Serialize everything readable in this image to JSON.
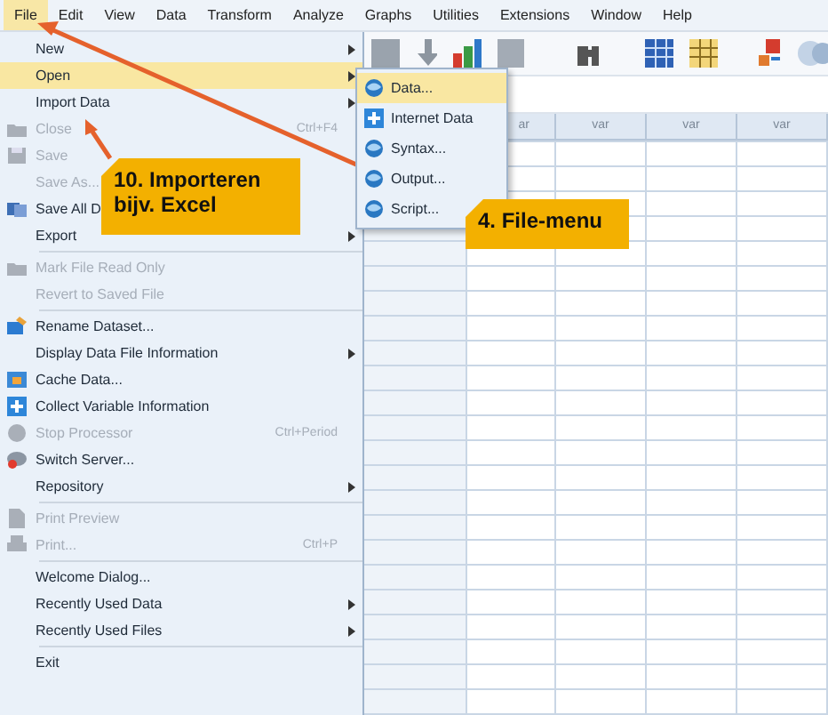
{
  "menu_bar": [
    {
      "label": "File",
      "selected": true
    },
    {
      "label": "Edit",
      "selected": false
    },
    {
      "label": "View",
      "selected": false
    },
    {
      "label": "Data",
      "selected": false
    },
    {
      "label": "Transform",
      "selected": false
    },
    {
      "label": "Analyze",
      "selected": false
    },
    {
      "label": "Graphs",
      "selected": false
    },
    {
      "label": "Utilities",
      "selected": false
    },
    {
      "label": "Extensions",
      "selected": false
    },
    {
      "label": "Window",
      "selected": false
    },
    {
      "label": "Help",
      "selected": false
    }
  ],
  "file_menu": [
    {
      "kind": "item",
      "label": "New",
      "submenu": true,
      "disabled": false,
      "selected": false
    },
    {
      "kind": "item",
      "label": "Open",
      "submenu": true,
      "disabled": false,
      "selected": true
    },
    {
      "kind": "item",
      "label": "Import Data",
      "submenu": true,
      "disabled": false,
      "selected": false
    },
    {
      "kind": "item",
      "label": "Close",
      "shortcut": "Ctrl+F4",
      "disabled": true,
      "selected": false
    },
    {
      "kind": "item",
      "label": "Save",
      "disabled": true,
      "selected": false
    },
    {
      "kind": "item",
      "label": "Save As...",
      "disabled": true,
      "selected": false
    },
    {
      "kind": "item",
      "label": "Save All D",
      "disabled": false,
      "selected": false
    },
    {
      "kind": "item",
      "label": "Export",
      "submenu": true,
      "disabled": false,
      "selected": false
    },
    {
      "kind": "separator"
    },
    {
      "kind": "item",
      "label": "Mark File Read Only",
      "disabled": true,
      "selected": false
    },
    {
      "kind": "item",
      "label": "Revert to Saved File",
      "disabled": true,
      "selected": false
    },
    {
      "kind": "separator"
    },
    {
      "kind": "item",
      "label": "Rename Dataset...",
      "disabled": false,
      "selected": false
    },
    {
      "kind": "item",
      "label": "Display Data File Information",
      "submenu": true,
      "disabled": false,
      "selected": false
    },
    {
      "kind": "item",
      "label": "Cache Data...",
      "disabled": false,
      "selected": false
    },
    {
      "kind": "item",
      "label": "Collect Variable Information",
      "disabled": false,
      "selected": false
    },
    {
      "kind": "item",
      "label": "Stop Processor",
      "shortcut": "Ctrl+Period",
      "disabled": true,
      "selected": false
    },
    {
      "kind": "item",
      "label": "Switch Server...",
      "disabled": false,
      "selected": false
    },
    {
      "kind": "item",
      "label": "Repository",
      "submenu": true,
      "disabled": false,
      "selected": false
    },
    {
      "kind": "separator"
    },
    {
      "kind": "item",
      "label": "Print Preview",
      "disabled": true,
      "selected": false
    },
    {
      "kind": "item",
      "label": "Print...",
      "shortcut": "Ctrl+P",
      "disabled": true,
      "selected": false
    },
    {
      "kind": "separator"
    },
    {
      "kind": "item",
      "label": "Welcome Dialog...",
      "disabled": false,
      "selected": false
    },
    {
      "kind": "item",
      "label": "Recently Used Data",
      "submenu": true,
      "disabled": false,
      "selected": false
    },
    {
      "kind": "item",
      "label": "Recently Used Files",
      "submenu": true,
      "disabled": false,
      "selected": false
    },
    {
      "kind": "separator"
    },
    {
      "kind": "item",
      "label": "Exit",
      "disabled": false,
      "selected": false
    }
  ],
  "open_submenu": [
    {
      "label": "Data...",
      "selected": true
    },
    {
      "label": "Internet Data",
      "selected": false
    },
    {
      "label": "Syntax...",
      "selected": false
    },
    {
      "label": "Output...",
      "selected": false
    },
    {
      "label": "Script...",
      "selected": false
    }
  ],
  "grid": {
    "columns": [
      "ar",
      "var",
      "var",
      "var"
    ]
  },
  "annotations": [
    {
      "text": "10. Importeren bijv. Excel"
    },
    {
      "text": "4. File-menu"
    }
  ]
}
